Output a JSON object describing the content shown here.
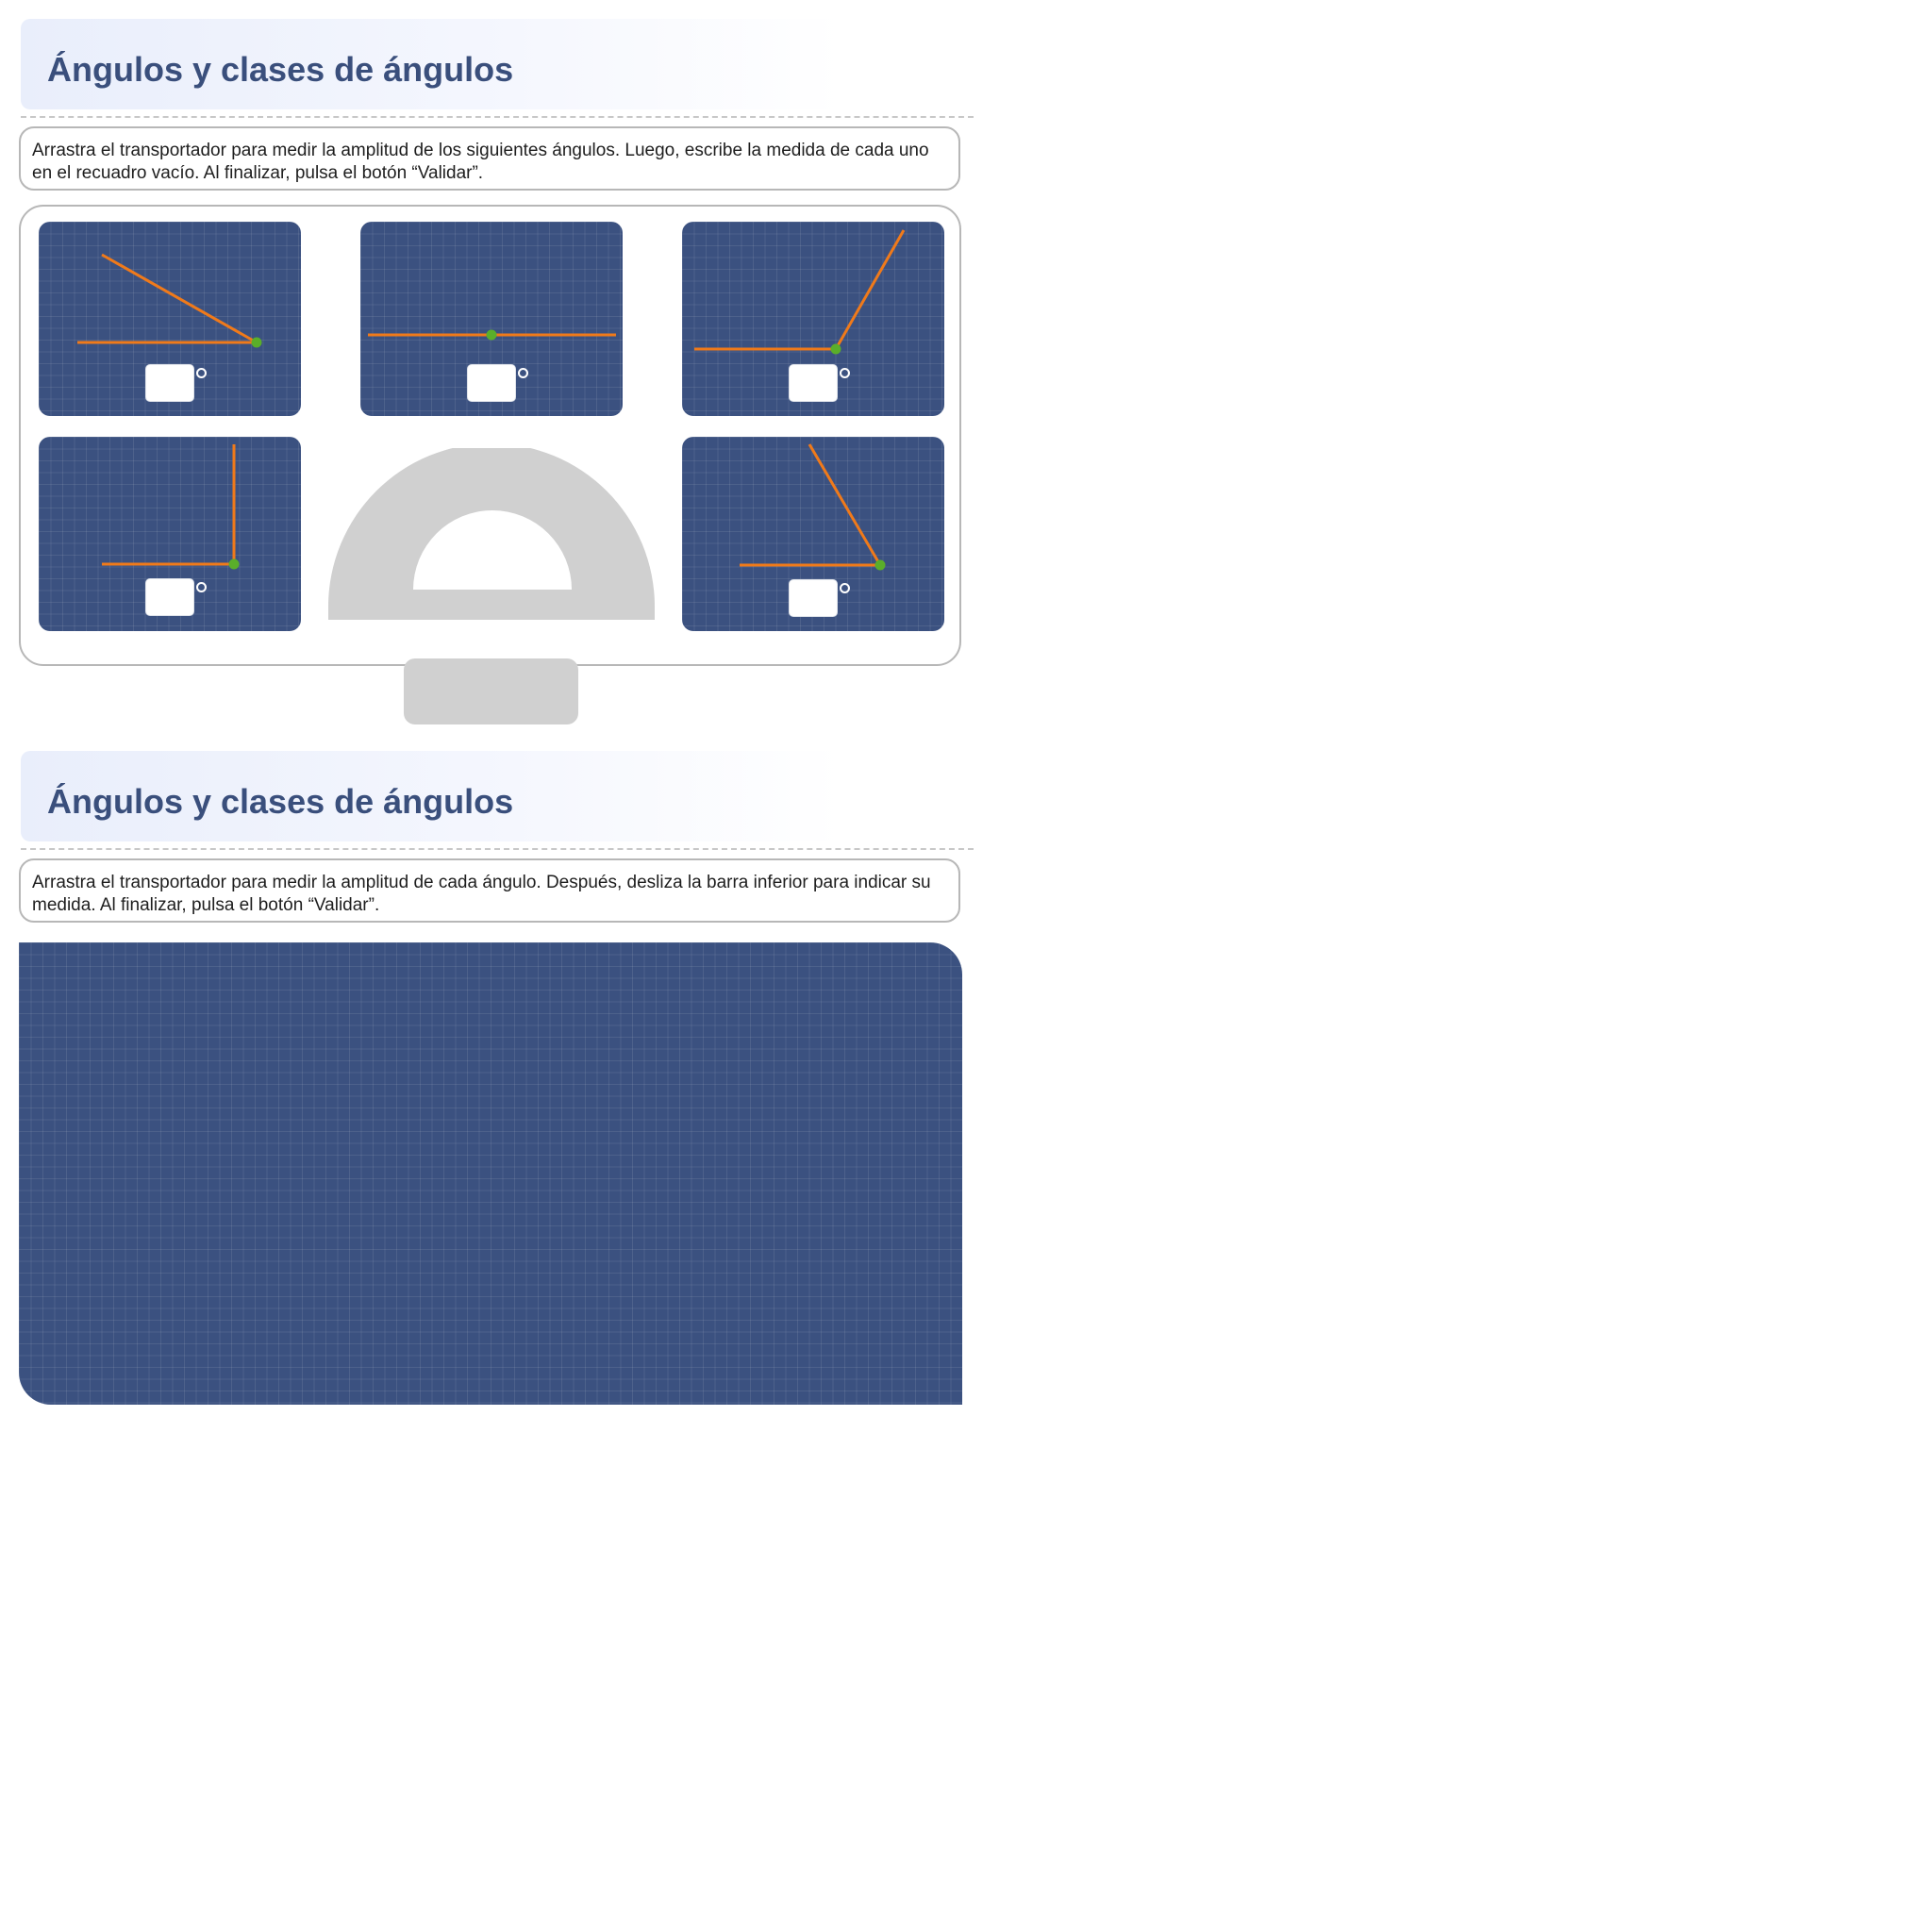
{
  "section1": {
    "title": "Ángulos y clases de ángulos",
    "instructions": "Arrastra el transportador para medir la amplitud de los siguientes ángulos. Luego, escribe la medida de cada uno en el recuadro vacío. Al finalizar, pulsa el botón “Validar”.",
    "angle_cards": [
      {
        "id": "angle-1",
        "answer": "",
        "degree_symbol": "°"
      },
      {
        "id": "angle-2",
        "answer": "",
        "degree_symbol": "°"
      },
      {
        "id": "angle-3",
        "answer": "",
        "degree_symbol": "°"
      },
      {
        "id": "angle-4",
        "answer": "",
        "degree_symbol": "°"
      },
      {
        "id": "angle-5",
        "answer": "",
        "degree_symbol": "°"
      }
    ],
    "validate_label": ""
  },
  "section2": {
    "title": "Ángulos y clases de ángulos",
    "instructions": "Arrastra el transportador para medir la amplitud de cada ángulo. Después, desliza la barra inferior para indicar su medida. Al finalizar, pulsa el botón “Validar”."
  },
  "colors": {
    "title": "#3a4f7c",
    "card_bg": "#3b5180",
    "ray": "#f07a1a",
    "vertex": "#5aae2a",
    "protractor": "#d0d0d0",
    "border": "#b7b7b7"
  }
}
